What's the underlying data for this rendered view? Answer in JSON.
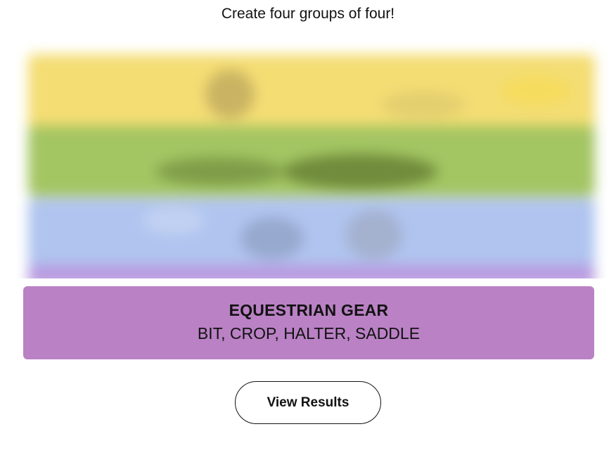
{
  "instructions": "Create four groups of four!",
  "board": {
    "state": "blurred",
    "band_colors": [
      "#f4dd73",
      "#a3c562",
      "#b0c4ef",
      "#b99be0"
    ]
  },
  "solved_group": {
    "title": "EQUESTRIAN GEAR",
    "members": "BIT, CROP, HALTER, SADDLE",
    "color": "#ba81c5"
  },
  "actions": {
    "view_results_label": "View Results"
  }
}
